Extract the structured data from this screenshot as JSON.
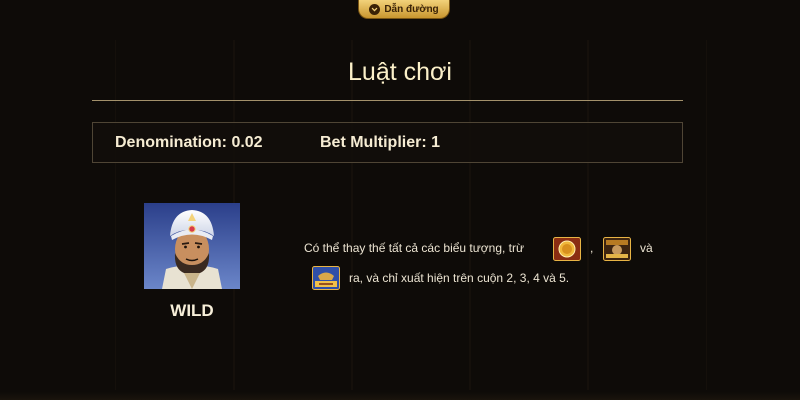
{
  "guide_tab": {
    "label": "Dẫn đường",
    "icon": "chevron-down-icon"
  },
  "page": {
    "title": "Luật chơi"
  },
  "info": {
    "denomination": "Denomination: 0.02",
    "bet_multiplier": "Bet Multiplier: 1"
  },
  "wild": {
    "label": "WILD",
    "icon": "sultan-wild-icon",
    "description_part1": "Có thể thay thế tất cả các biểu tượng, trừ",
    "separator": ",",
    "and_word": "và",
    "description_part2": "ra, và chỉ xuất hiện trên cuộn 2, 3, 4 và 5.",
    "excluded_symbols": [
      "gold-coin-symbol-icon",
      "free-spin-symbol-icon",
      "bonus-symbol-icon"
    ]
  },
  "colors": {
    "background": "#0e0b08",
    "accent_gold": "#d9a93f",
    "title": "#fbf0c9"
  }
}
